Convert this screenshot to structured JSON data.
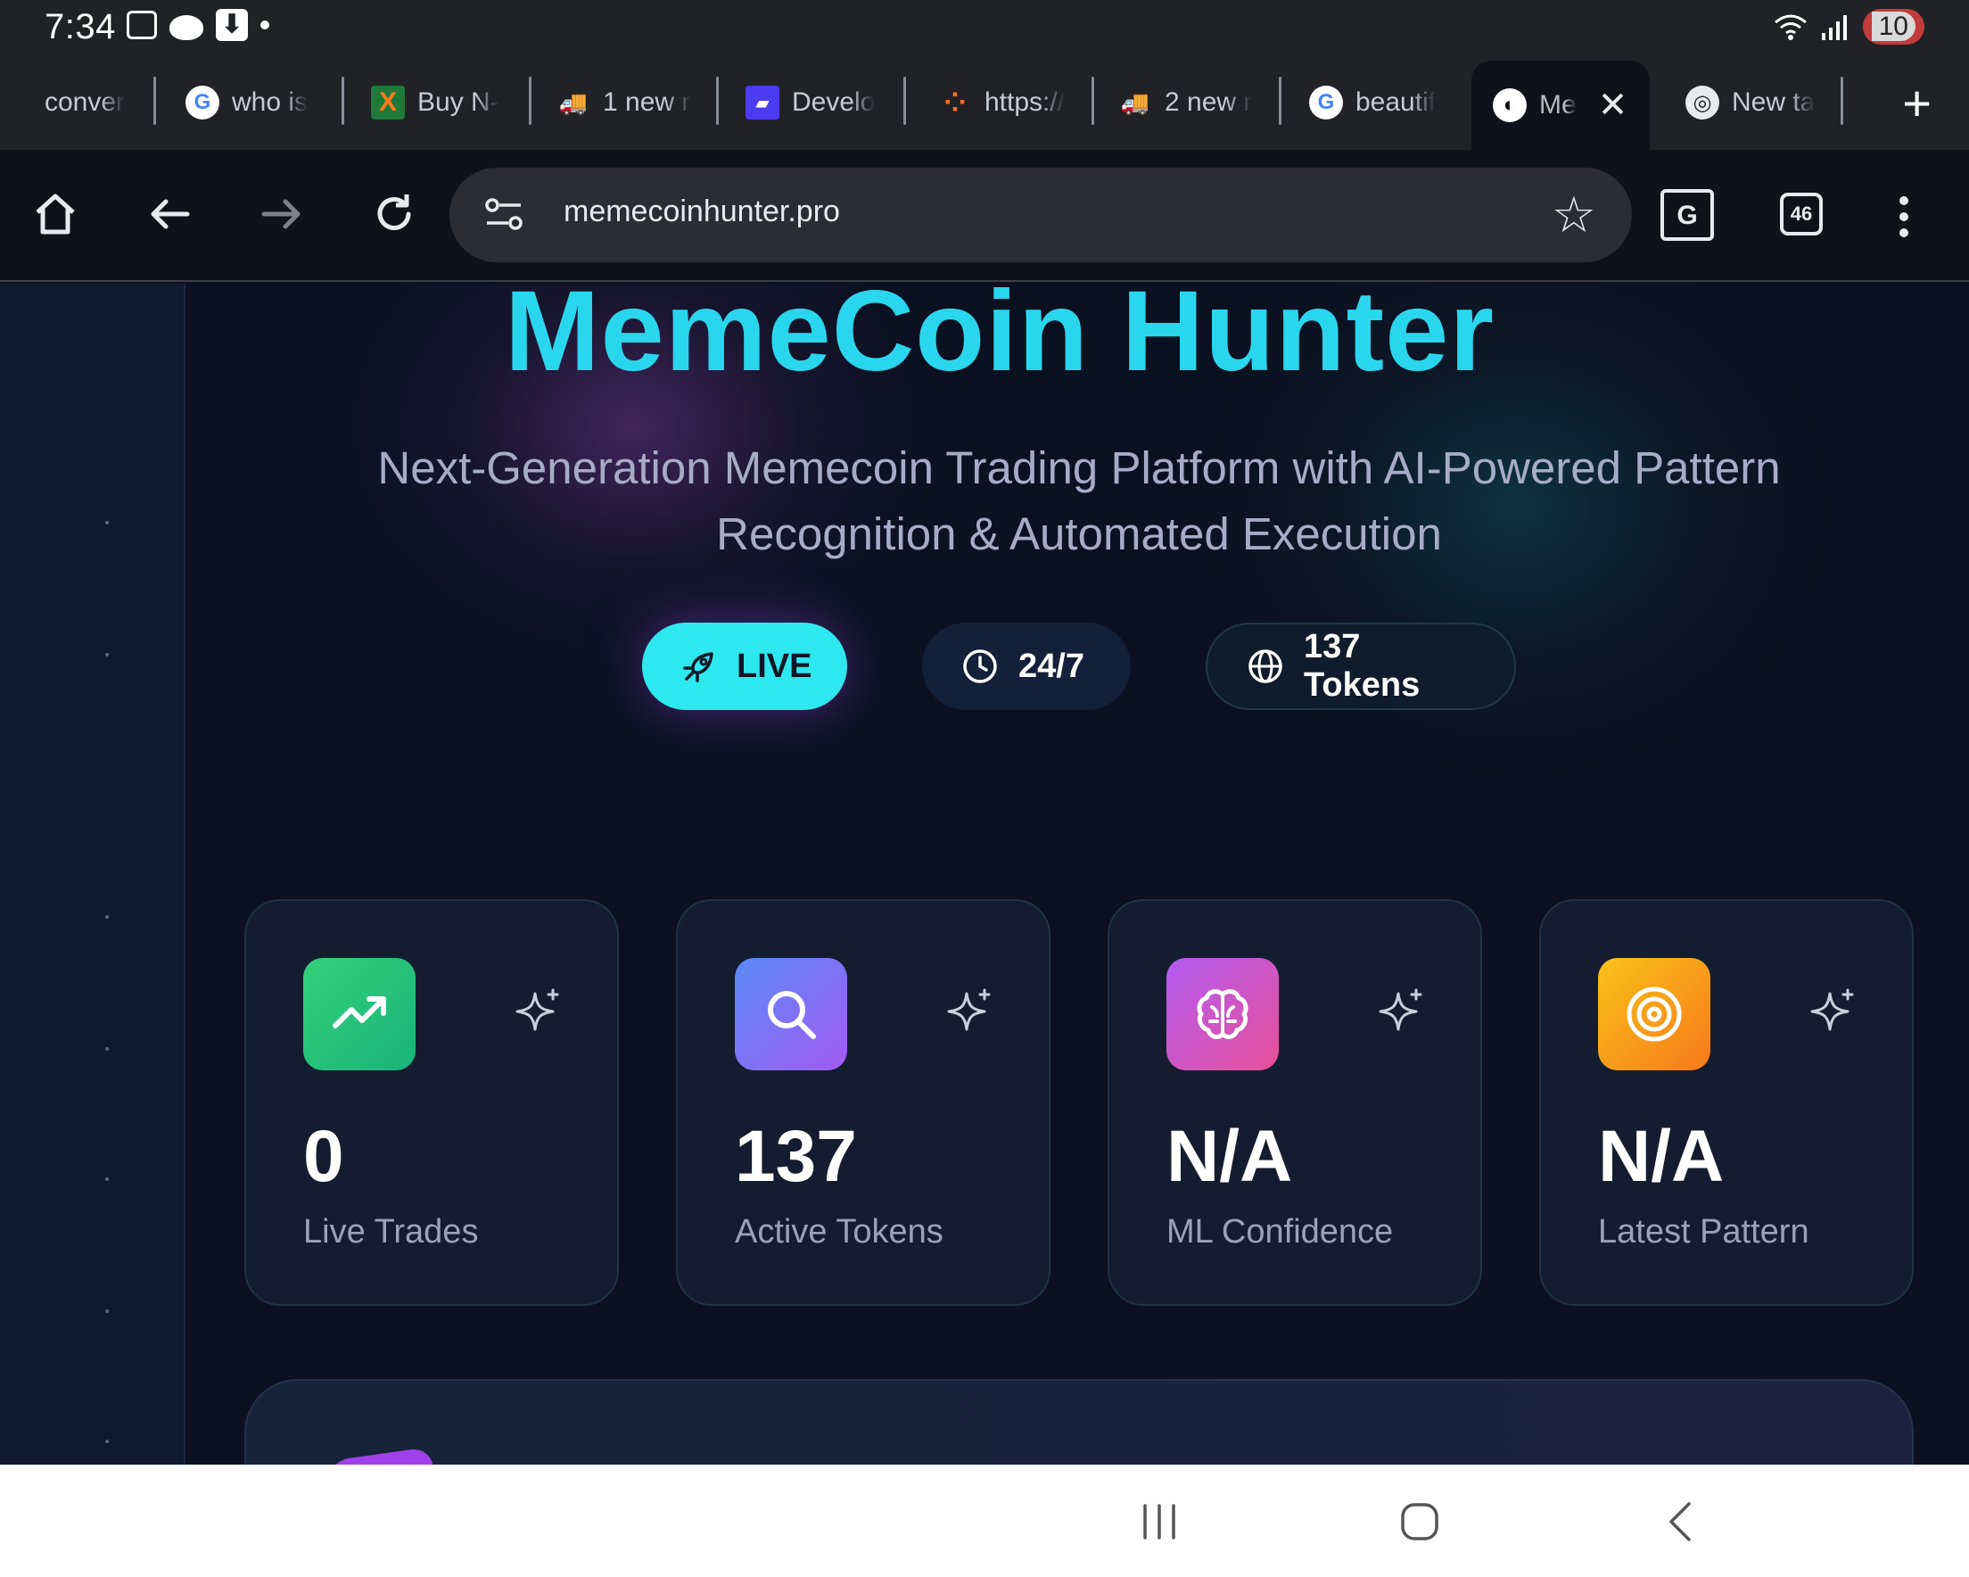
{
  "status_bar": {
    "time": "7:34",
    "battery": "10"
  },
  "tabs": [
    {
      "label": "conver",
      "favicon": "none"
    },
    {
      "label": "who is",
      "favicon": "google-icon"
    },
    {
      "label": "Buy N-",
      "favicon": "x-logo-icon"
    },
    {
      "label": "1 new n",
      "favicon": "truck-icon"
    },
    {
      "label": "Develo",
      "favicon": "dev-icon"
    },
    {
      "label": "https://",
      "favicon": "orange-logo-icon"
    },
    {
      "label": "2 new r",
      "favicon": "truck-icon"
    },
    {
      "label": "beautif",
      "favicon": "google-icon"
    },
    {
      "label": "Me",
      "favicon": "globe-icon",
      "active": true
    },
    {
      "label": "New ta",
      "favicon": "chrome-icon"
    }
  ],
  "toolbar": {
    "url": "memecoinhunter.pro",
    "tab_count": "46"
  },
  "hero": {
    "title": "MemeCoin Hunter",
    "subtitle_line1": "Next-Generation Memecoin Trading Platform with AI-Powered Pattern",
    "subtitle_line2": "Recognition & Automated Execution"
  },
  "pills": {
    "live": "LIVE",
    "uptime": "24/7",
    "tokens": "137 Tokens"
  },
  "stats": [
    {
      "value": "0",
      "label": "Live Trades",
      "icon": "trending-up-icon",
      "color": "#22c17a"
    },
    {
      "value": "137",
      "label": "Active Tokens",
      "icon": "search-icon",
      "color": "#8b6cf6"
    },
    {
      "value": "N/A",
      "label": "ML Confidence",
      "icon": "brain-icon",
      "color": "#c056e8"
    },
    {
      "value": "N/A",
      "label": "Latest Pattern",
      "icon": "target-icon",
      "color": "#f7a21a"
    }
  ],
  "colors": {
    "accent_cyan": "#2ad6ee",
    "page_bg": "#0b1120",
    "card_bg": "#141d30"
  }
}
